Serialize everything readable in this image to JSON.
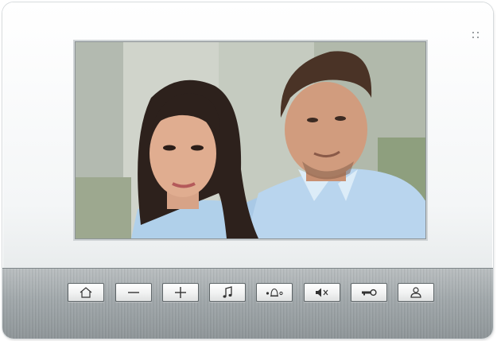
{
  "screen": {
    "content": "video-feed",
    "description_icon": "live-camera-image"
  },
  "buttons": [
    {
      "id": "home",
      "icon": "home-icon"
    },
    {
      "id": "minus",
      "icon": "minus-icon"
    },
    {
      "id": "plus",
      "icon": "plus-icon"
    },
    {
      "id": "ringtone",
      "icon": "music-note-icon"
    },
    {
      "id": "bell",
      "icon": "doorbell-icon"
    },
    {
      "id": "mute",
      "icon": "mute-icon"
    },
    {
      "id": "unlock",
      "icon": "key-icon"
    },
    {
      "id": "talk",
      "icon": "user-icon"
    }
  ],
  "colors": {
    "frame": "#f4f6f7",
    "panel": "#9fa6a9",
    "button": "#f0f1f1",
    "button_border": "#5f6669",
    "icon": "#333333"
  }
}
